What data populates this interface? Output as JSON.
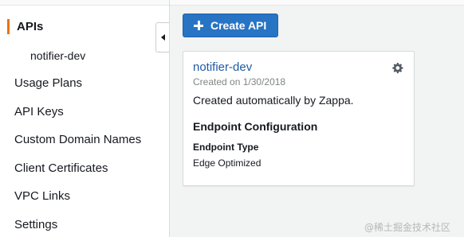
{
  "sidebar": {
    "items": [
      {
        "label": "APIs"
      },
      {
        "label": "notifier-dev"
      },
      {
        "label": "Usage Plans"
      },
      {
        "label": "API Keys"
      },
      {
        "label": "Custom Domain Names"
      },
      {
        "label": "Client Certificates"
      },
      {
        "label": "VPC Links"
      },
      {
        "label": "Settings"
      }
    ]
  },
  "toolbar": {
    "create_label": "Create API"
  },
  "api_card": {
    "name": "notifier-dev",
    "created": "Created on 1/30/2018",
    "description": "Created automatically by Zappa.",
    "section_title": "Endpoint Configuration",
    "endpoint_type_label": "Endpoint Type",
    "endpoint_type_value": "Edge Optimized"
  },
  "watermark": "@稀土掘金技术社区",
  "colors": {
    "accent": "#ec7211",
    "primary_button": "#2874c4",
    "link": "#1f5aa6"
  }
}
